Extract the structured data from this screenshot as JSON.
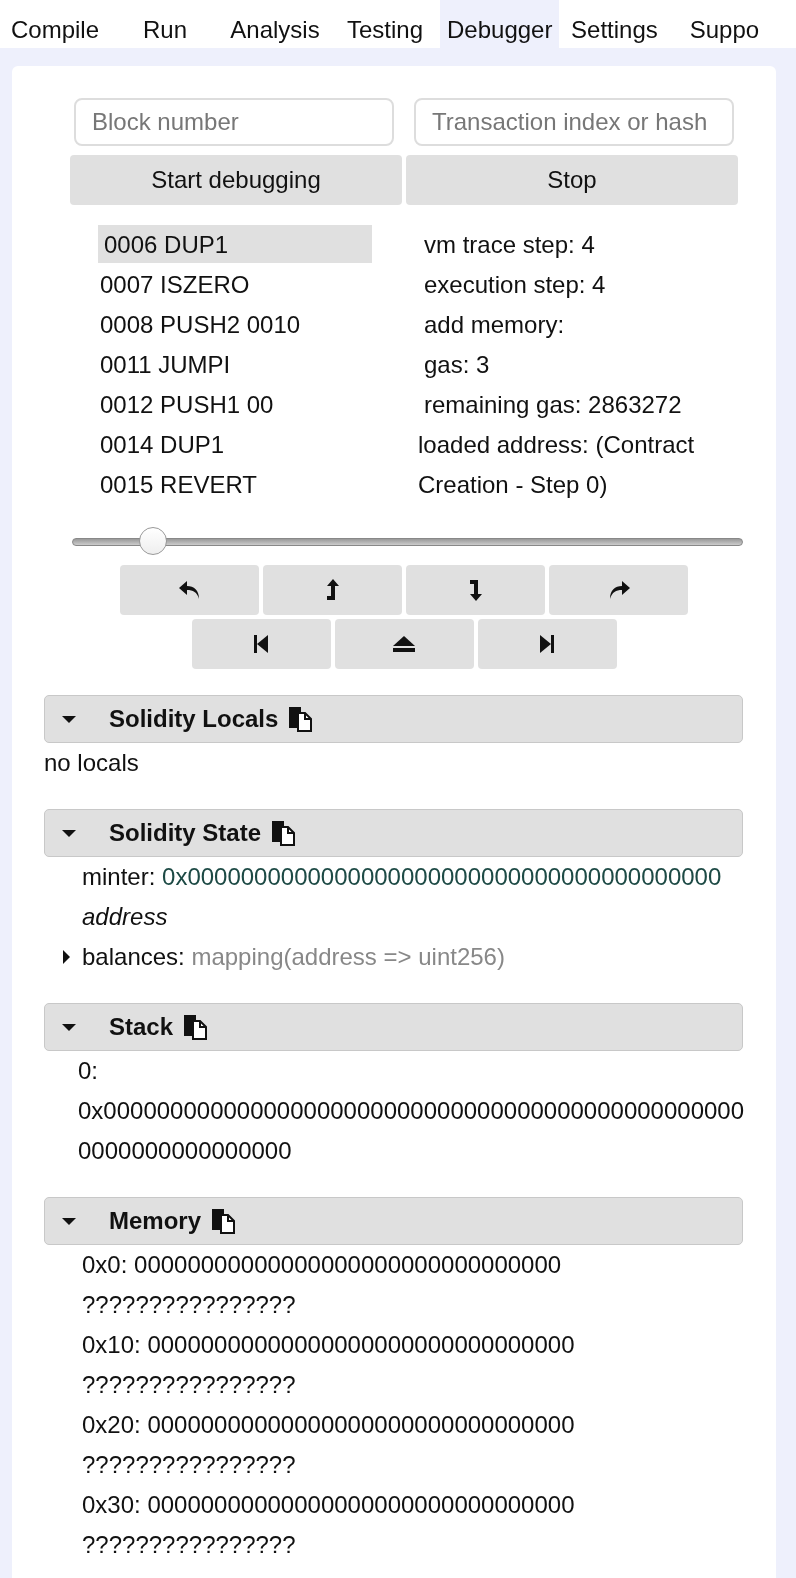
{
  "tabs": [
    {
      "label": "Compile",
      "selected": false
    },
    {
      "label": "Run",
      "selected": false
    },
    {
      "label": "Analysis",
      "selected": false
    },
    {
      "label": "Testing",
      "selected": false
    },
    {
      "label": "Debugger",
      "selected": true
    },
    {
      "label": "Settings",
      "selected": false
    },
    {
      "label": "Suppo",
      "selected": false
    }
  ],
  "debugger": {
    "block_field": {
      "placeholder": "Block number"
    },
    "transaction_field": {
      "placeholder": "Transaction index or hash"
    },
    "buttons": [
      "Start debugging",
      "Stop"
    ],
    "instructions": [
      {
        "text": "0006 DUP1",
        "selected": true
      },
      {
        "text": "0007 ISZERO",
        "selected": false
      },
      {
        "text": "0008 PUSH2 0010",
        "selected": false
      },
      {
        "text": "0011 JUMPI",
        "selected": false
      },
      {
        "text": "0012 PUSH1 00",
        "selected": false
      },
      {
        "text": "0014 DUP1",
        "selected": false
      },
      {
        "text": "0015 REVERT",
        "selected": false
      }
    ],
    "step_info": [
      "vm trace step: 4",
      "execution step: 4",
      "add memory:",
      "gas: 3",
      "remaining gas: 2863272",
      "loaded address: (Contract Creation - Step 0)"
    ],
    "slider": {
      "level": 0.12
    }
  },
  "sections": [
    {
      "title": "Solidity Locals",
      "expanded": true,
      "kind": "text",
      "text": "no locals"
    },
    {
      "title": "Solidity State",
      "expanded": true,
      "kind": "state",
      "items": [
        {
          "kind": "value",
          "name": "minter:",
          "value": "0x0000000000000000000000000000000000000000",
          "type": "address"
        },
        {
          "kind": "mapping",
          "name": "balances:",
          "type": "mapping(address => uint256)",
          "expanded": false
        }
      ]
    },
    {
      "title": "Stack",
      "expanded": true,
      "kind": "lines",
      "lines": [
        "0:",
        "0x000000000000000000000000000000000000000000000000",
        "0000000000000000"
      ]
    },
    {
      "title": "Memory",
      "expanded": true,
      "kind": "memory",
      "rows": [
        {
          "address": "0x0:",
          "hex": "00000000000000000000000000000000",
          "ascii": "????????????????"
        },
        {
          "address": "0x10:",
          "hex": "00000000000000000000000000000000",
          "ascii": "????????????????"
        },
        {
          "address": "0x20:",
          "hex": "00000000000000000000000000000000",
          "ascii": "????????????????"
        },
        {
          "address": "0x30:",
          "hex": "00000000000000000000000000000000",
          "ascii": "????????????????"
        }
      ]
    }
  ]
}
